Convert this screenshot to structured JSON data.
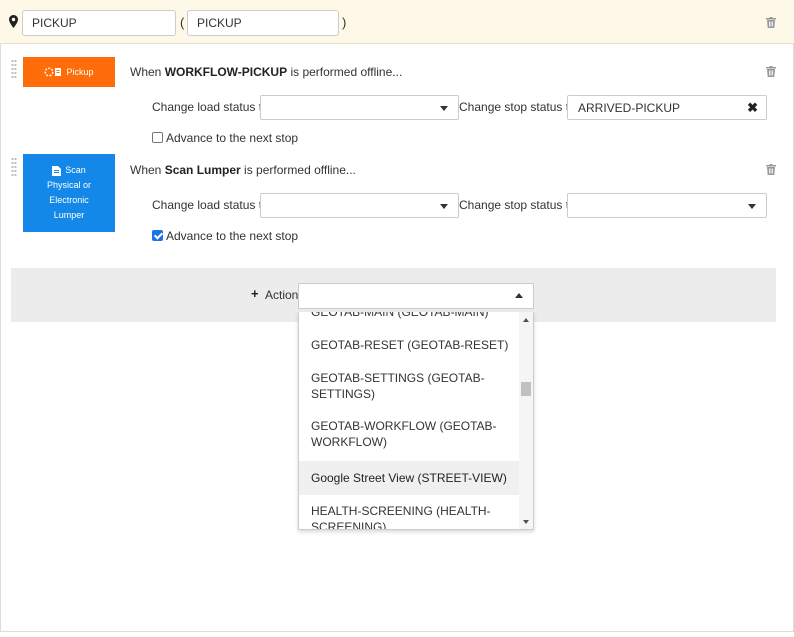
{
  "header": {
    "location_value": "PICKUP",
    "location_alt_value": "PICKUP",
    "paren_open": "(",
    "paren_close": ")"
  },
  "rules": [
    {
      "badge_label": "Pickup",
      "badge_color": "#ff6c0a",
      "badge_icon": "spinner-icon",
      "when_prefix": "When ",
      "when_action": "WORKFLOW-PICKUP",
      "when_suffix": " is performed offline...",
      "load_status_label": "Change load status to",
      "load_status_value": "",
      "stop_status_label": "Change stop status to",
      "stop_status_value": "ARRIVED-PICKUP",
      "advance_label": "Advance to the next stop",
      "advance_checked": false
    },
    {
      "badge_label_lines": [
        "Scan",
        "Physical or",
        "Electronic",
        "Lumper"
      ],
      "badge_color": "#1488e8",
      "badge_icon": "document-icon",
      "when_prefix": "When ",
      "when_action": "Scan Lumper",
      "when_suffix": " is performed offline...",
      "load_status_label": "Change load status to",
      "load_status_value": "",
      "stop_status_label": "Change stop status to",
      "stop_status_value": "",
      "advance_label": "Advance to the next stop",
      "advance_checked": true
    }
  ],
  "action": {
    "plus": "+",
    "label": "Action",
    "value": "",
    "options": [
      "GEOTAB-MAIN (GEOTAB-MAIN)",
      "GEOTAB-RESET (GEOTAB-RESET)",
      "GEOTAB-SETTINGS (GEOTAB-SETTINGS)",
      "GEOTAB-WORKFLOW (GEOTAB-WORKFLOW)",
      "Google Street View (STREET-VIEW)",
      "HEALTH-SCREENING (HEALTH-SCREENING)"
    ],
    "highlighted_option": "Google Street View (STREET-VIEW)"
  },
  "colors": {
    "header_bg": "#fdf8e7",
    "orange": "#ff6c0a",
    "blue": "#1488e8",
    "action_bar_bg": "#ececec"
  }
}
